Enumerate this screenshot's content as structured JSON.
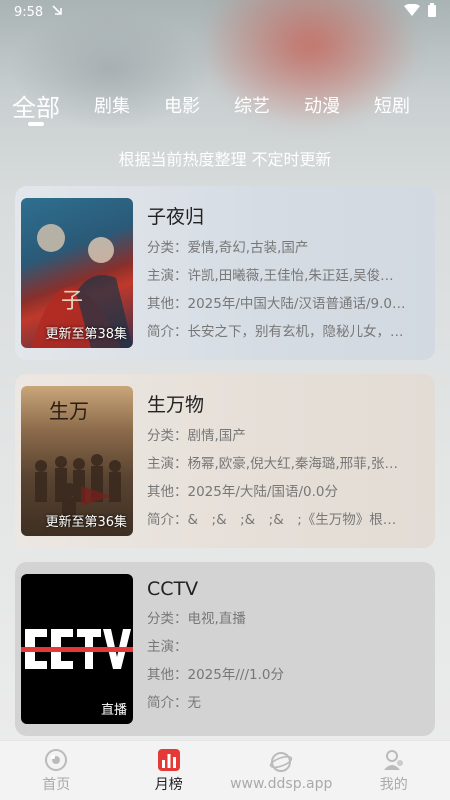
{
  "status": {
    "time": "9:58"
  },
  "tabs": [
    {
      "label": "全部",
      "active": true
    },
    {
      "label": "剧集"
    },
    {
      "label": "电影"
    },
    {
      "label": "综艺"
    },
    {
      "label": "动漫"
    },
    {
      "label": "短剧"
    }
  ],
  "subtitle": "根据当前热度整理 不定时更新",
  "items": [
    {
      "title": "子夜归",
      "badge": "更新至第38集",
      "category": "分类：爱情,奇幻,古装,国产",
      "cast": "主演：许凯,田曦薇,王佳怡,朱正廷,吴俊…",
      "other": "其他：2025年/中国大陆/汉语普通话/9.0…",
      "intro": "简介：长安之下，别有玄机，隐秘儿女，…"
    },
    {
      "title": "生万物",
      "badge": "更新至第36集",
      "category": "分类：剧情,国产",
      "cast": "主演：杨幂,欧豪,倪大红,秦海璐,邢菲,张…",
      "other": "其他：2025年/大陆/国语/0.0分",
      "intro": "简介：&　;&　;&　;&　;《生万物》根…"
    },
    {
      "title": "CCTV",
      "badge": "直播",
      "category": "分类：电视,直播",
      "cast": "主演：",
      "other": "其他：2025年///1.0分",
      "intro": "简介：无"
    }
  ],
  "nav": [
    {
      "label": "首页",
      "icon": "home-icon"
    },
    {
      "label": "月榜",
      "icon": "chart-icon",
      "active": true
    },
    {
      "label": "www.ddsp.app",
      "icon": "planet-icon"
    },
    {
      "label": "我的",
      "icon": "user-icon"
    }
  ],
  "colors": {
    "accent": "#e53935",
    "card3_bg": "#d3d3d3"
  }
}
